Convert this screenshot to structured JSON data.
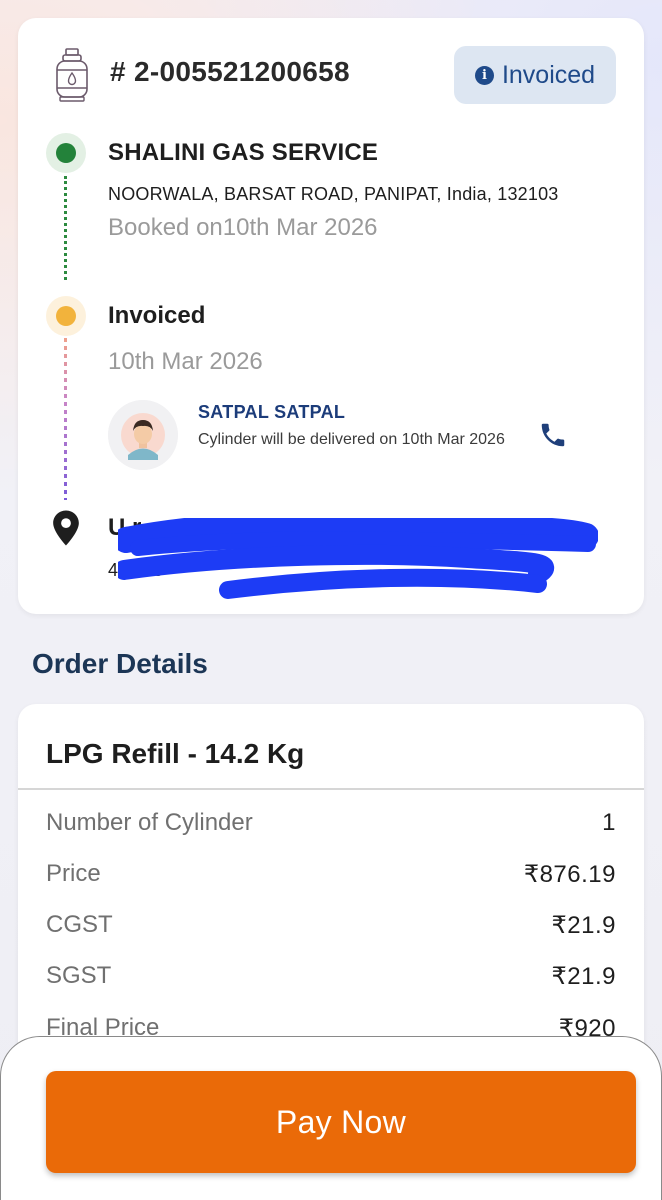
{
  "order": {
    "id": "# 2-005521200658",
    "status": "Invoiced"
  },
  "timeline": {
    "distributor": {
      "name": "SHALINI GAS SERVICE",
      "address": "NOORWALA, BARSAT ROAD, PANIPAT, India, 132103",
      "booked": "Booked on10th Mar 2026"
    },
    "invoiced": {
      "title": "Invoiced",
      "date": "10th Mar 2026",
      "agent_name": "SATPAL SATPAL",
      "agent_note": "Cylinder will be delivered on 10th Mar 2026"
    },
    "destination": {
      "name": "U         r",
      "address": "41                                    103",
      "redacted": true
    }
  },
  "order_details": {
    "section_title": "Order Details",
    "product": "LPG Refill - 14.2 Kg",
    "rows": [
      {
        "label": "Number of Cylinder",
        "value": "1"
      },
      {
        "label": "Price",
        "value": "₹876.19"
      },
      {
        "label": "CGST",
        "value": "₹21.9"
      },
      {
        "label": "SGST",
        "value": "₹21.9"
      },
      {
        "label": "Final Price",
        "value": "₹920"
      }
    ]
  },
  "actions": {
    "pay_label": "Pay Now"
  },
  "colors": {
    "accent": "#ea6a08",
    "badge_bg": "#dde6f2",
    "badge_text": "#1f4a8a",
    "green": "#23823a",
    "yellow": "#f2b33c",
    "redaction": "#1d3cf5"
  },
  "icons": [
    "gas-cylinder-icon",
    "info-icon",
    "phone-icon",
    "location-pin-icon",
    "delivery-agent-avatar"
  ]
}
